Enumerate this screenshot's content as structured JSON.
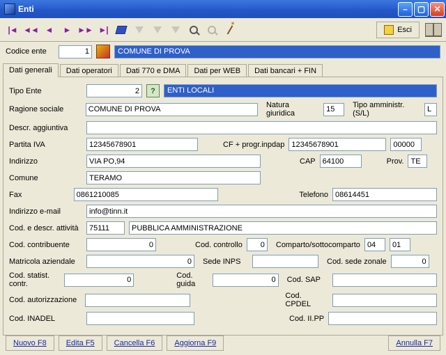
{
  "window": {
    "title": "Enti"
  },
  "toolbar": {
    "esci_label": "Esci"
  },
  "codice": {
    "label": "Codice ente",
    "value": "1",
    "name": "COMUNE DI PROVA"
  },
  "tabs": [
    "Dati generali",
    "Dati operatori",
    "Dati 770 e DMA",
    "Dati per WEB",
    "Dati bancari + FIN"
  ],
  "form": {
    "tipo_ente": {
      "label": "Tipo Ente",
      "value": "2",
      "desc": "ENTI LOCALI"
    },
    "ragione_sociale": {
      "label": "Ragione sociale",
      "value": "COMUNE DI PROVA"
    },
    "natura_giuridica": {
      "label": "Natura giuridica",
      "value": "15"
    },
    "tipo_amministr": {
      "label": "Tipo amministr.(S/L)",
      "value": "L"
    },
    "descr_agg": {
      "label": "Descr. aggiuntiva",
      "value": ""
    },
    "partita_iva": {
      "label": "Partita IVA",
      "value": "12345678901"
    },
    "cf_progr": {
      "label": "CF + progr.inpdap",
      "value1": "12345678901",
      "value2": "00000"
    },
    "indirizzo": {
      "label": "Indirizzo",
      "value": "VIA PO,94"
    },
    "cap": {
      "label": "CAP",
      "value": "64100"
    },
    "prov": {
      "label": "Prov.",
      "value": "TE"
    },
    "comune": {
      "label": "Comune",
      "value": "TERAMO"
    },
    "fax": {
      "label": "Fax",
      "value": "0861210085"
    },
    "telefono": {
      "label": "Telefono",
      "value": "08614451"
    },
    "email": {
      "label": "Indirizzo e-mail",
      "value": "info@tinn.it"
    },
    "attivita": {
      "label": "Cod. e descr. attività",
      "code": "75111",
      "desc": "PUBBLICA AMMINISTRAZIONE"
    },
    "cod_contribuente": {
      "label": "Cod. contribuente",
      "value": "0"
    },
    "cod_controllo": {
      "label": "Cod. controllo",
      "value": "0"
    },
    "comparto": {
      "label": "Comparto/sottocomparto",
      "value1": "04",
      "value2": "01"
    },
    "matricola": {
      "label": "Matricola aziendale",
      "value": "0"
    },
    "sede_inps": {
      "label": "Sede INPS",
      "value": ""
    },
    "cod_sede_zonale": {
      "label": "Cod. sede zonale",
      "value": "0"
    },
    "cod_statist": {
      "label": "Cod. statist. contr.",
      "value": "0"
    },
    "cod_guida": {
      "label": "Cod. guida",
      "value": "0"
    },
    "cod_sap": {
      "label": "Cod. SAP",
      "value": ""
    },
    "cod_autorizz": {
      "label": "Cod. autorizzazione",
      "value": ""
    },
    "cod_cpdel": {
      "label": "Cod. CPDEL",
      "value": ""
    },
    "cod_inadel": {
      "label": "Cod. INADEL",
      "value": ""
    },
    "cod_iipp": {
      "label": "Cod. II.PP",
      "value": ""
    }
  },
  "buttons": {
    "nuovo": "Nuovo  F8",
    "edita": "Edita  F5",
    "cancella": "Cancella  F6",
    "aggiorna": "Aggiorna  F9",
    "annulla": "Annulla  F7"
  }
}
